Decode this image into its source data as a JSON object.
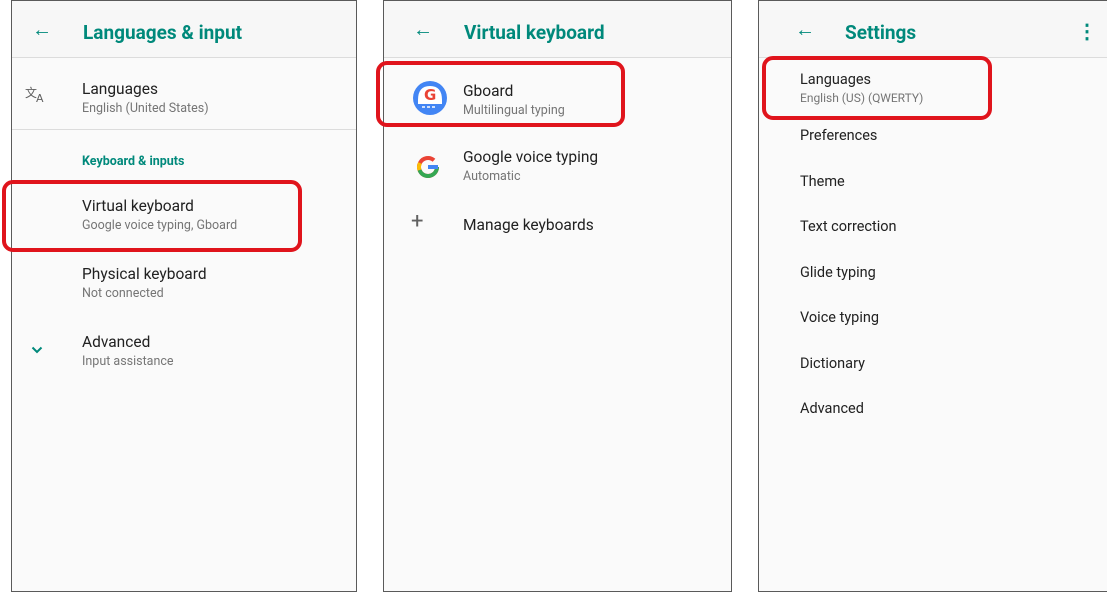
{
  "screen1": {
    "title": "Languages & input",
    "languages": {
      "label": "Languages",
      "value": "English (United States)"
    },
    "category": "Keyboard & inputs",
    "virtual_keyboard": {
      "label": "Virtual keyboard",
      "value": "Google voice typing, Gboard"
    },
    "physical_keyboard": {
      "label": "Physical keyboard",
      "value": "Not connected"
    },
    "advanced": {
      "label": "Advanced",
      "value": "Input assistance"
    }
  },
  "screen2": {
    "title": "Virtual keyboard",
    "gboard": {
      "label": "Gboard",
      "value": "Multilingual typing"
    },
    "voice": {
      "label": "Google voice typing",
      "value": "Automatic"
    },
    "manage": {
      "label": "Manage keyboards"
    }
  },
  "screen3": {
    "title": "Settings",
    "languages": {
      "label": "Languages",
      "value": "English (US) (QWERTY)"
    },
    "items": [
      "Preferences",
      "Theme",
      "Text correction",
      "Glide typing",
      "Voice typing",
      "Dictionary",
      "Advanced"
    ]
  },
  "colors": {
    "accent": "#00897b",
    "highlight": "#e0141c"
  }
}
